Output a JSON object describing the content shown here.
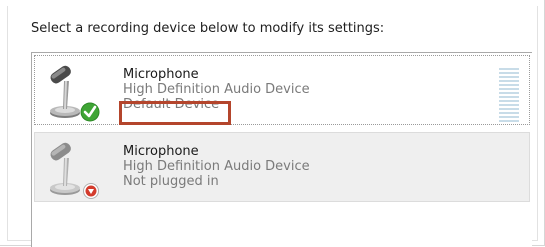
{
  "dialog": {
    "prompt": "Select a recording device below to modify its settings:"
  },
  "devices": [
    {
      "name": "Microphone",
      "description": "High Definition Audio Device",
      "status": "Default Device",
      "icon": "microphone-default-icon",
      "badge": "green-check",
      "state": "default"
    },
    {
      "name": "Microphone",
      "description": "High Definition Audio Device",
      "status": "Not plugged in",
      "icon": "microphone-unplugged-icon",
      "badge": "red-down-arrow",
      "state": "unplugged"
    }
  ],
  "level_meter": {
    "segments": 14,
    "level": 0
  },
  "colors": {
    "highlight_box": "#b4452c",
    "check_badge": "#3fa535",
    "unplugged_badge": "#d33b2c",
    "meter_segment": "#c8dce8"
  }
}
